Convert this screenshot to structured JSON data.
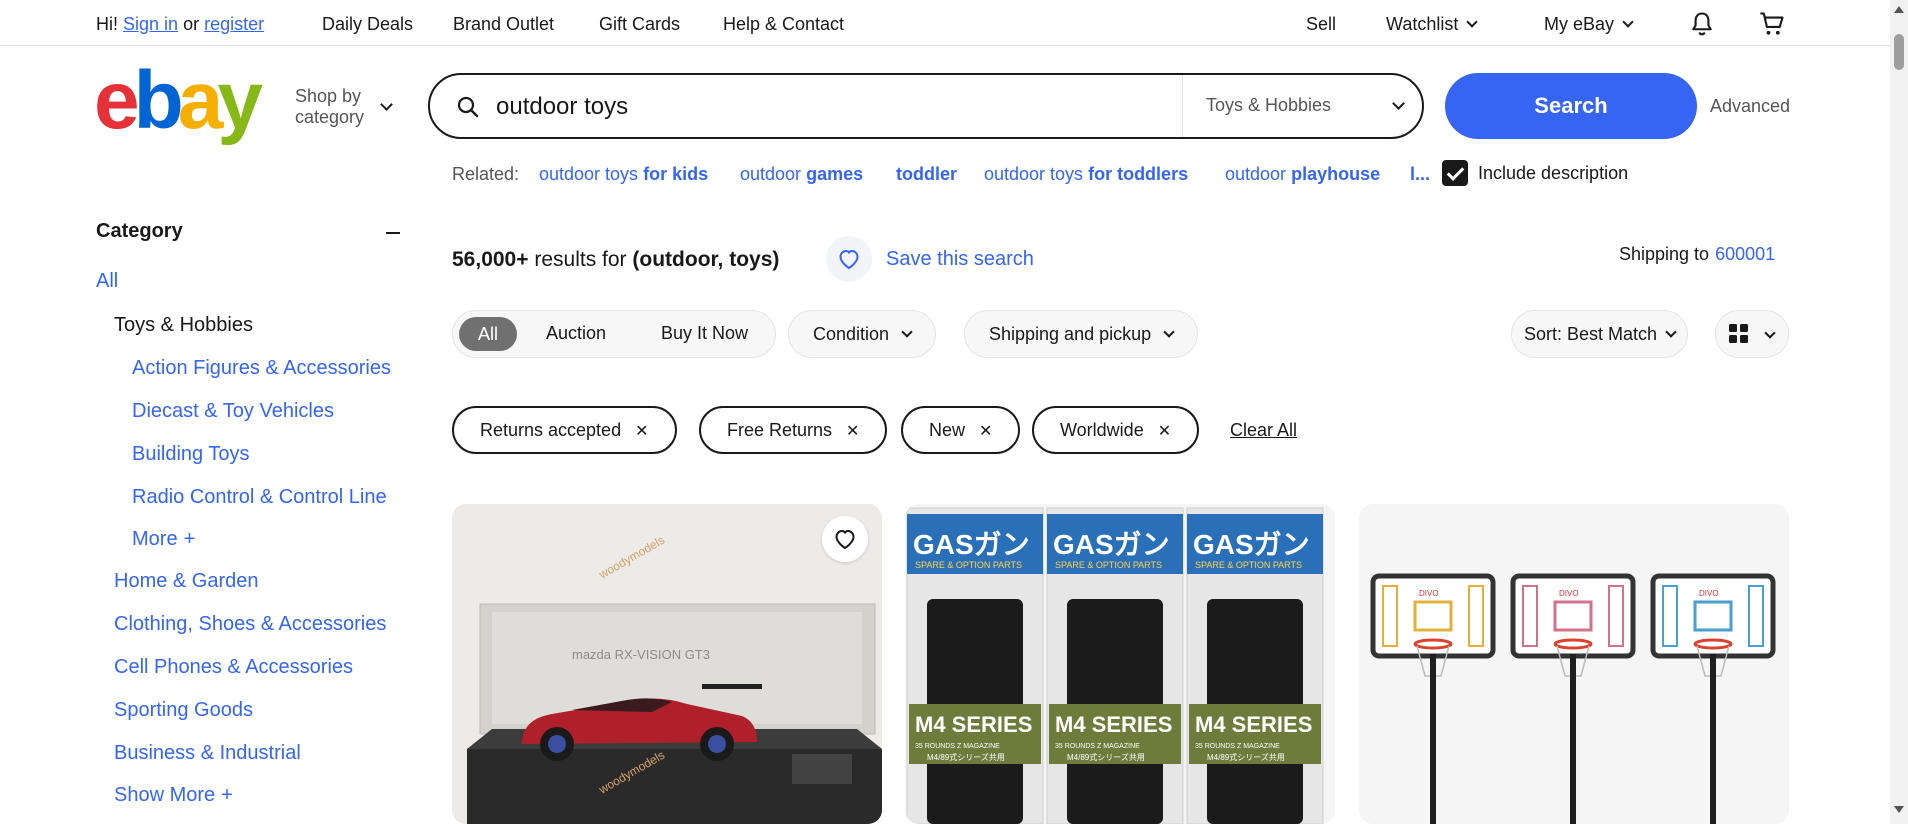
{
  "topbar": {
    "greeting": "Hi!",
    "sign_in": "Sign in",
    "or": "or",
    "register": "register",
    "links": [
      "Daily Deals",
      "Brand Outlet",
      "Gift Cards",
      "Help & Contact"
    ],
    "sell": "Sell",
    "watchlist": "Watchlist",
    "my_ebay": "My eBay"
  },
  "header": {
    "logo": "ebay",
    "shop_by_category_line1": "Shop by",
    "shop_by_category_line2": "category"
  },
  "search": {
    "query": "outdoor toys",
    "category": "Toys & Hobbies",
    "button": "Search",
    "advanced": "Advanced"
  },
  "related": {
    "label": "Related:",
    "items": [
      {
        "base": "outdoor toys",
        "bold": "for kids"
      },
      {
        "base": "outdoor",
        "bold": "games"
      },
      {
        "base": "",
        "bold": "toddler"
      },
      {
        "base": "outdoor toys",
        "bold": "for toddlers"
      },
      {
        "base": "outdoor",
        "bold": "playhouse"
      },
      {
        "base": "",
        "bold": "l..."
      }
    ]
  },
  "include_description": {
    "label": "Include description",
    "checked": true
  },
  "sidebar": {
    "heading": "Category",
    "all": "All",
    "current": "Toys & Hobbies",
    "subcategories": [
      "Action Figures & Accessories",
      "Diecast & Toy Vehicles",
      "Building Toys",
      "Radio Control & Control Line"
    ],
    "more": "More",
    "siblings": [
      "Home & Garden",
      "Clothing, Shoes & Accessories",
      "Cell Phones & Accessories",
      "Sporting Goods",
      "Business & Industrial"
    ],
    "show_more": "Show More"
  },
  "results": {
    "count": "56,000+",
    "results_for": "results for",
    "terms": "(outdoor, toys)",
    "save_search": "Save this search",
    "shipping_to": "Shipping to",
    "zip": "600001"
  },
  "filters": {
    "listing_types": [
      "All",
      "Auction",
      "Buy It Now"
    ],
    "active_listing_type": "All",
    "condition": "Condition",
    "shipping": "Shipping and pickup",
    "sort": "Sort: Best Match"
  },
  "applied_filters": [
    "Returns accepted",
    "Free Returns",
    "New",
    "Worldwide"
  ],
  "clear_all": "Clear All",
  "products": [
    {
      "watermark": "woodymodels",
      "box_text": "mazda RX-VISION GT3"
    },
    {
      "brand": "GASガン",
      "sub": "SPARE & OPTION PARTS",
      "series": "M4 SERIES",
      "detail": "35 ROUNDS Z MAGAZINE",
      "jp": "M4/89式シリーズ共用"
    },
    {
      "brand": "DIVO"
    }
  ],
  "colors": {
    "accent": "#3665f3",
    "logo_e": "#e53238",
    "logo_b": "#0064d2",
    "logo_a": "#f5af02",
    "logo_y": "#86b817"
  }
}
